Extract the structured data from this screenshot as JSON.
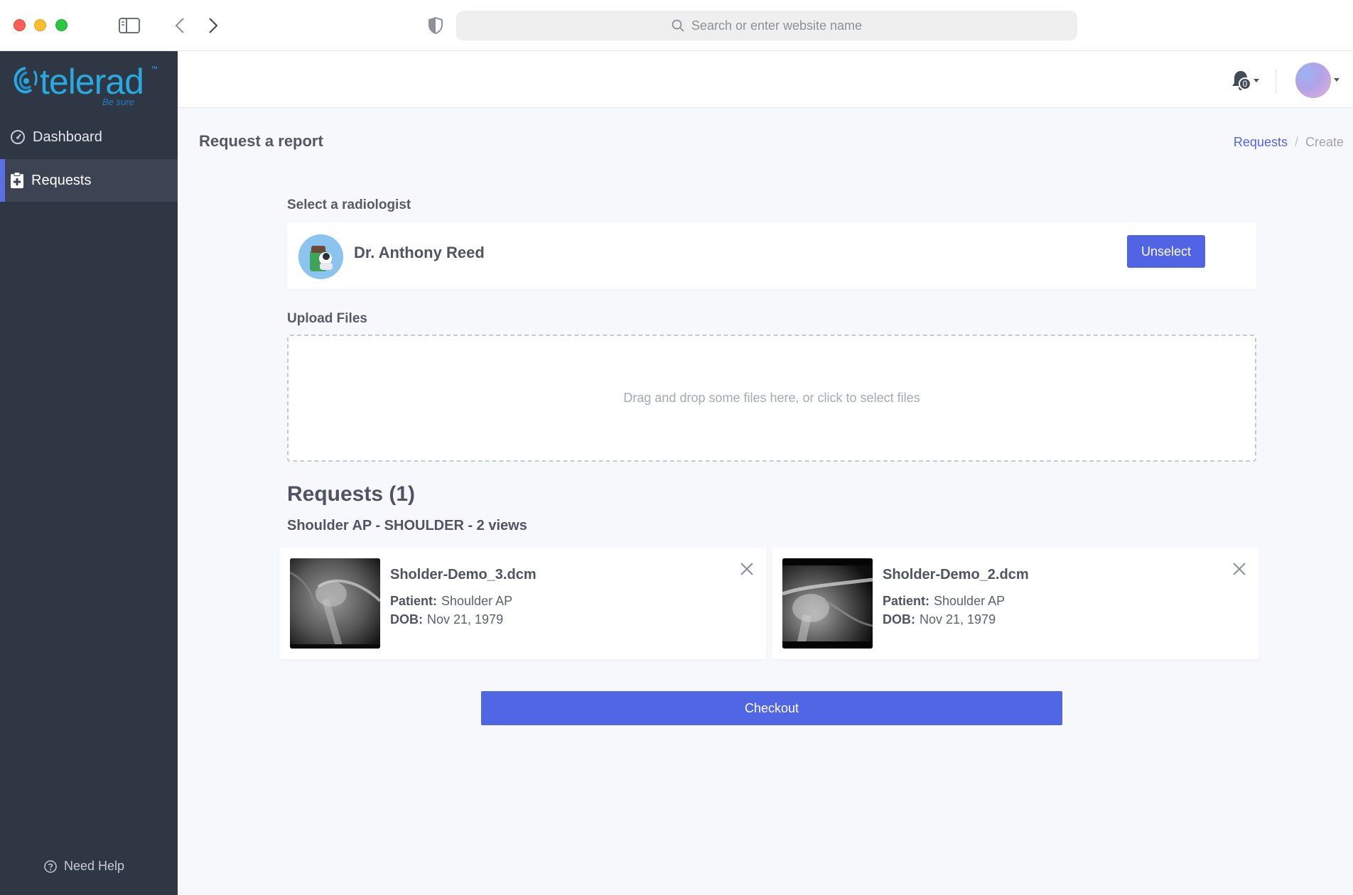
{
  "browser": {
    "address_placeholder": "Search or enter website name"
  },
  "sidebar": {
    "logo": {
      "word": "telerad",
      "tm": "™",
      "tagline": "Be sure"
    },
    "items": [
      {
        "label": "Dashboard",
        "icon": "gauge-icon",
        "active": false
      },
      {
        "label": "Requests",
        "icon": "clipboard-plus-icon",
        "active": true
      }
    ],
    "help_label": "Need Help"
  },
  "topbar": {
    "notification_count": "0"
  },
  "page": {
    "title": "Request a report",
    "breadcrumb": {
      "link": "Requests",
      "separator": "/",
      "current": "Create"
    }
  },
  "radiologist": {
    "section_label": "Select a radiologist",
    "name": "Dr. Anthony Reed",
    "unselect_label": "Unselect"
  },
  "upload": {
    "section_label": "Upload Files",
    "dropzone_text": "Drag and drop some files here, or click to select files"
  },
  "requests": {
    "title": "Requests (1)",
    "study": "Shoulder AP - SHOULDER - 2 views",
    "files": [
      {
        "name": "Sholder-Demo_3.dcm",
        "patient_label": "Patient:",
        "patient": "Shoulder AP",
        "dob_label": "DOB:",
        "dob": "Nov 21, 1979"
      },
      {
        "name": "Sholder-Demo_2.dcm",
        "patient_label": "Patient:",
        "patient": "Shoulder AP",
        "dob_label": "DOB:",
        "dob": "Nov 21, 1979"
      }
    ]
  },
  "checkout_label": "Checkout",
  "colors": {
    "accent": "#5166e4",
    "sidebar_bg": "#2f3644",
    "logo": "#2aa9e0"
  }
}
